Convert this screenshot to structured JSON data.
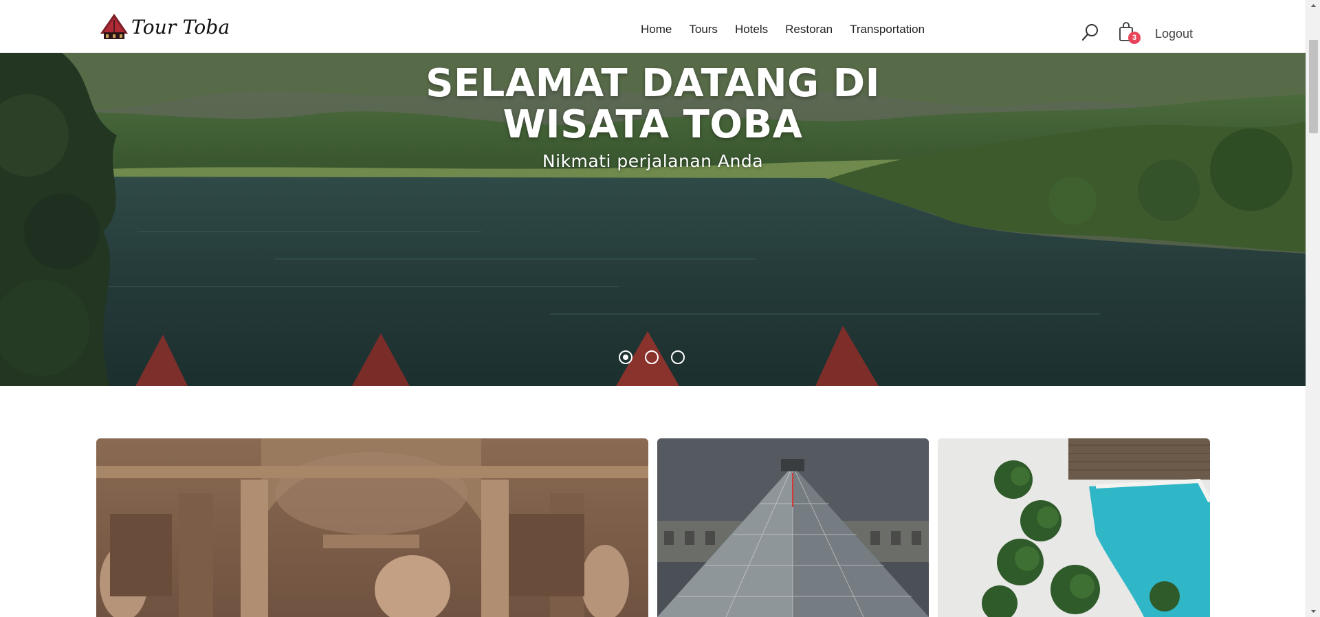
{
  "brand": {
    "name": "Tour Toba",
    "logo_icon": "toba-house-icon"
  },
  "nav": {
    "items": [
      "Home",
      "Tours",
      "Hotels",
      "Restoran",
      "Transportation"
    ]
  },
  "header_actions": {
    "search_icon": "search-icon",
    "cart_icon": "shopping-bag-icon",
    "cart_count": "3",
    "logout_label": "Logout"
  },
  "hero": {
    "title_line1": "SELAMAT DATANG DI",
    "title_line2": "WISATA TOBA",
    "subtitle": "Nikmati perjalanan Anda",
    "slides": [
      {
        "active": true
      },
      {
        "active": false
      },
      {
        "active": false
      }
    ]
  },
  "cards": [
    {
      "name": "fountain-sculpture-card"
    },
    {
      "name": "glass-pyramid-card"
    },
    {
      "name": "resort-pool-card"
    }
  ],
  "colors": {
    "badge": "#e8455b",
    "text_dark": "#222222",
    "hero_text": "#ffffff"
  }
}
